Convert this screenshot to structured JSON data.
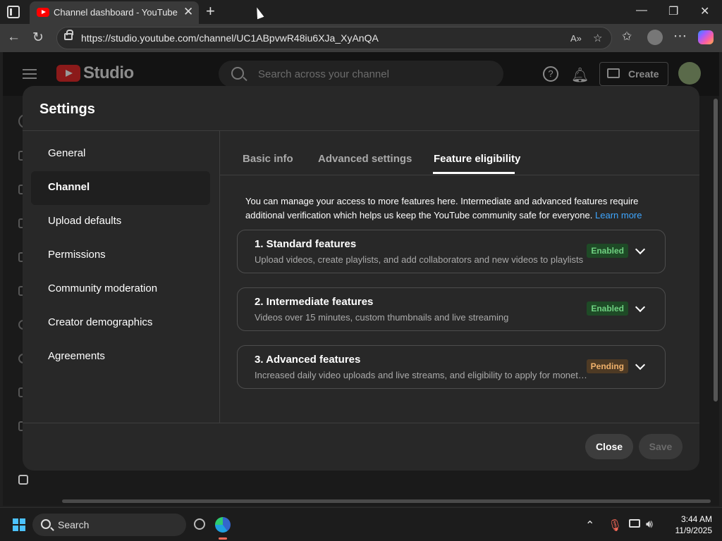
{
  "browser": {
    "tab_title": "Channel dashboard - YouTube Studio",
    "url": "https://studio.youtube.com/channel/UC1ABpvwR48iu6XJa_XyAnQA"
  },
  "studio": {
    "logo_text": "Studio",
    "search_placeholder": "Search across your channel",
    "create_label": "Create"
  },
  "settings": {
    "title": "Settings",
    "nav": [
      {
        "label": "General"
      },
      {
        "label": "Channel",
        "active": true
      },
      {
        "label": "Upload defaults"
      },
      {
        "label": "Permissions"
      },
      {
        "label": "Community moderation"
      },
      {
        "label": "Creator demographics"
      },
      {
        "label": "Agreements"
      }
    ],
    "tabs": [
      {
        "label": "Basic info"
      },
      {
        "label": "Advanced settings"
      },
      {
        "label": "Feature eligibility",
        "active": true
      }
    ],
    "description": "You can manage your access to more features here. Intermediate and advanced features require additional verification which helps us keep the YouTube community safe for everyone.",
    "learn_more": "Learn more",
    "features": [
      {
        "title": "1. Standard features",
        "subtitle": "Upload videos, create playlists, and add collaborators and new videos to playlists",
        "status": "Enabled"
      },
      {
        "title": "2. Intermediate features",
        "subtitle": "Videos over 15 minutes, custom thumbnails and live streaming",
        "status": "Enabled"
      },
      {
        "title": "3. Advanced features",
        "subtitle": "Increased daily video uploads and live streams, and eligibility to apply for moneti...",
        "status": "Pending"
      }
    ],
    "close_label": "Close",
    "save_label": "Save"
  },
  "taskbar": {
    "search_label": "Search",
    "time": "3:44 AM",
    "date": "11/9/2025"
  },
  "colors": {
    "link": "#3ea6ff",
    "enabled_bg": "#1e4a26",
    "enabled_text": "#6fd181",
    "pending_bg": "#4e3a24",
    "pending_text": "#f0b16b"
  }
}
